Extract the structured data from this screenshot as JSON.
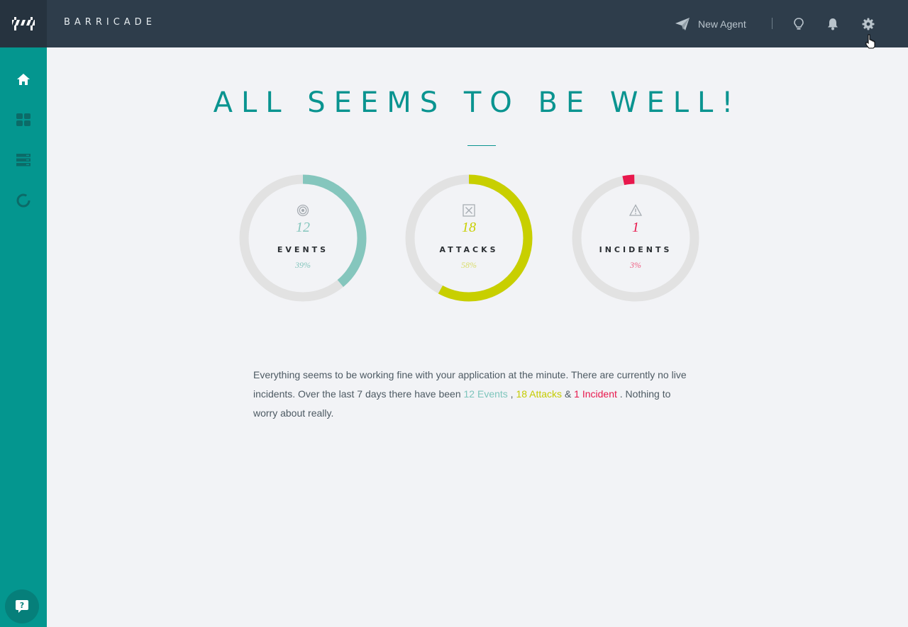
{
  "app": {
    "brand": "BARRICADE"
  },
  "header": {
    "new_agent_label": "New Agent",
    "icons": [
      "paper-plane-icon",
      "lightbulb-icon",
      "bell-icon",
      "gear-icon"
    ]
  },
  "sidebar": {
    "items": [
      {
        "icon": "home-icon"
      },
      {
        "icon": "dashboard-grid-icon"
      },
      {
        "icon": "server-list-icon"
      },
      {
        "icon": "loading-ring-icon"
      }
    ],
    "help_icon": "help-chat-icon"
  },
  "main": {
    "title": "ALL SEEMS TO BE WELL!",
    "gauges": [
      {
        "icon": "target-icon",
        "count": "12",
        "label": "EVENTS",
        "percent_text": "39%",
        "fraction": 0.39,
        "color": "#85c6bd"
      },
      {
        "icon": "x-box-icon",
        "count": "18",
        "label": "ATTACKS",
        "percent_text": "58%",
        "fraction": 0.58,
        "color": "#c8cf00"
      },
      {
        "icon": "warning-icon",
        "count": "1",
        "label": "INCIDENTS",
        "percent_text": "3%",
        "fraction": 0.03,
        "color": "#e8174c"
      }
    ],
    "summary": {
      "part1": "Everything seems to be working fine with your application at the minute. There are currently no live incidents. Over the last 7 days there have been ",
      "events_link": "12 Events",
      "sep1": " , ",
      "attacks_link": "18 Attacks",
      "sep2": " & ",
      "incidents_link": "1 Incident",
      "part2": " . Nothing to worry about really."
    }
  },
  "colors": {
    "teal": "#04968f",
    "navy": "#2e3d4b",
    "track": "#e2e2e2"
  }
}
